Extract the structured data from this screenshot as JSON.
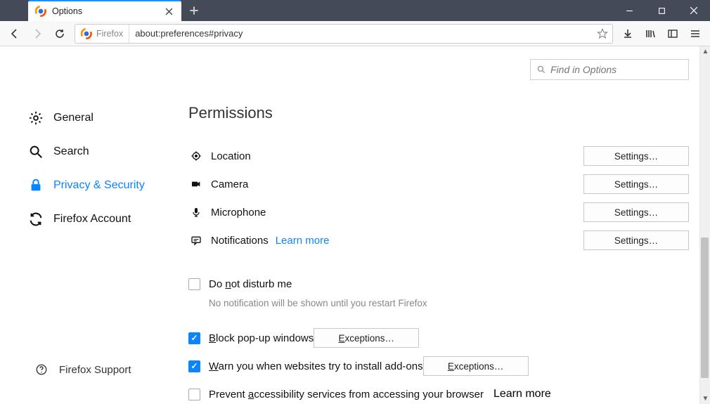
{
  "window": {
    "tab_title": "Options"
  },
  "urlbar": {
    "identity_label": "Firefox",
    "url": "about:preferences#privacy"
  },
  "search": {
    "placeholder": "Find in Options"
  },
  "sidebar": {
    "items": [
      {
        "label": "General"
      },
      {
        "label": "Search"
      },
      {
        "label": "Privacy & Security"
      },
      {
        "label": "Firefox Account"
      }
    ],
    "support": "Firefox Support"
  },
  "heading": "Permissions",
  "permissions": [
    {
      "label": "Location",
      "button": "Settings…"
    },
    {
      "label": "Camera",
      "button": "Settings…"
    },
    {
      "label": "Microphone",
      "button": "Settings…"
    },
    {
      "label": "Notifications",
      "button": "Settings…",
      "learn": "Learn more"
    }
  ],
  "checks": {
    "dnd_label": "Do not disturb me",
    "dnd_hint": "No notification will be shown until you restart Firefox",
    "popup_label": "Block pop-up windows",
    "addons_label": "Warn you when websites try to install add-ons",
    "a11y_label": "Prevent accessibility services from accessing your browser",
    "a11y_learn": "Learn more",
    "exceptions": "Exceptions…"
  }
}
